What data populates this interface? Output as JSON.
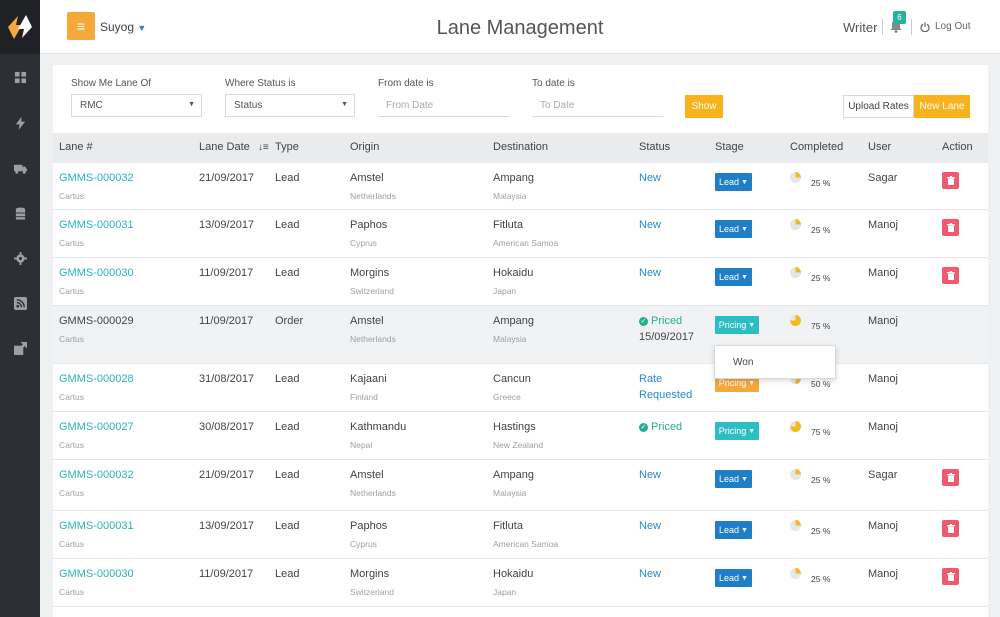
{
  "header": {
    "title": "Lane Management",
    "user_switch": "Suyog",
    "writer": "Writer",
    "notification_count": "6",
    "logout": "Log Out"
  },
  "sidebar": {
    "icons": [
      "dashboard-icon",
      "bolt-icon",
      "truck-icon",
      "database-icon",
      "gear-icon",
      "rss-icon",
      "export-icon"
    ]
  },
  "filters": {
    "show_me_lane_of_label": "Show Me Lane Of",
    "show_me_lane_of_value": "RMC",
    "where_status_label": "Where Status is",
    "where_status_value": "Status",
    "from_date_label": "From date is",
    "from_date_placeholder": "From Date",
    "to_date_label": "To date is",
    "to_date_placeholder": "To Date",
    "show_button": "Show",
    "upload_rates_button": "Upload Rates",
    "new_lane_button": "New Lane"
  },
  "table": {
    "columns": [
      "Lane #",
      "Lane Date",
      "Type",
      "Origin",
      "Destination",
      "Status",
      "Stage",
      "Completed",
      "User",
      "Action"
    ],
    "rows": [
      {
        "lane": "GMMS-000032",
        "company": "Cartus",
        "date": "21/09/2017",
        "type": "Lead",
        "origin": "Amstel",
        "origin_country": "Netherlands",
        "destination": "Ampang",
        "destination_country": "Malaysia",
        "status": "New",
        "status_line2": "",
        "stage": "Lead",
        "completed": "25 %",
        "completed_fraction": 0.25,
        "user": "Sagar"
      },
      {
        "lane": "GMMS-000031",
        "company": "Cartus",
        "date": "13/09/2017",
        "type": "Lead",
        "origin": "Paphos",
        "origin_country": "Cyprus",
        "destination": "Fitluta",
        "destination_country": "American Samoa",
        "status": "New",
        "status_line2": "",
        "stage": "Lead",
        "completed": "25 %",
        "completed_fraction": 0.25,
        "user": "Manoj"
      },
      {
        "lane": "GMMS-000030",
        "company": "Cartus",
        "date": "11/09/2017",
        "type": "Lead",
        "origin": "Morgins",
        "origin_country": "Switzerland",
        "destination": "Hokaidu",
        "destination_country": "Japan",
        "status": "New",
        "status_line2": "",
        "stage": "Lead",
        "completed": "25 %",
        "completed_fraction": 0.25,
        "user": "Manoj"
      },
      {
        "lane": "GMMS-000029",
        "company": "Cartus",
        "date": "11/09/2017",
        "type": "Order",
        "origin": "Amstel",
        "origin_country": "Netherlands",
        "destination": "Ampang",
        "destination_country": "Malaysia",
        "status": "Priced",
        "status_line2": "15/09/2017",
        "stage": "Pricing",
        "completed": "75 %",
        "completed_fraction": 0.75,
        "user": "Manoj"
      },
      {
        "lane": "GMMS-000028",
        "company": "Cartus",
        "date": "31/08/2017",
        "type": "Lead",
        "origin": "Kajaani",
        "origin_country": "Finland",
        "destination": "Cancun",
        "destination_country": "Greece",
        "status": "Rate",
        "status_line2": "Requested",
        "stage": "Pricing",
        "completed": "50 %",
        "completed_fraction": 0.5,
        "user": "Manoj"
      },
      {
        "lane": "GMMS-000027",
        "company": "Cartus",
        "date": "30/08/2017",
        "type": "Lead",
        "origin": "Kathmandu",
        "origin_country": "Nepal",
        "destination": "Hastings",
        "destination_country": "New Zealand",
        "status": "Priced",
        "status_line2": "",
        "stage": "Pricing",
        "completed": "75 %",
        "completed_fraction": 0.75,
        "user": "Manoj"
      },
      {
        "lane": "GMMS-000032",
        "company": "Cartus",
        "date": "21/09/2017",
        "type": "Lead",
        "origin": "Amstel",
        "origin_country": "Netherlands",
        "destination": "Ampang",
        "destination_country": "Malaysia",
        "status": "New",
        "status_line2": "",
        "stage": "Lead",
        "completed": "25 %",
        "completed_fraction": 0.25,
        "user": "Sagar"
      },
      {
        "lane": "GMMS-000031",
        "company": "Cartus",
        "date": "13/09/2017",
        "type": "Lead",
        "origin": "Paphos",
        "origin_country": "Cyprus",
        "destination": "Fitluta",
        "destination_country": "American Samoa",
        "status": "New",
        "status_line2": "",
        "stage": "Lead",
        "completed": "25 %",
        "completed_fraction": 0.25,
        "user": "Manoj"
      },
      {
        "lane": "GMMS-000030",
        "company": "Cartus",
        "date": "11/09/2017",
        "type": "Lead",
        "origin": "Morgins",
        "origin_country": "Switzerland",
        "destination": "Hokaidu",
        "destination_country": "Japan",
        "status": "New",
        "status_line2": "",
        "stage": "Lead",
        "completed": "25 %",
        "completed_fraction": 0.25,
        "user": "Manoj"
      }
    ]
  },
  "stage_dropdown": {
    "option": "Won"
  },
  "colors": {
    "accent": "#f9b21b",
    "menu_button": "#f6a93b",
    "lane_link": "#28b4b9",
    "status_new": "#2a8ad1",
    "status_priced": "#27ae8f",
    "stage_lead": "#1e7ec6",
    "stage_pricing": "#2bbfc3",
    "delete": "#ef5a6f",
    "pie_fill": "#f6b91b"
  }
}
